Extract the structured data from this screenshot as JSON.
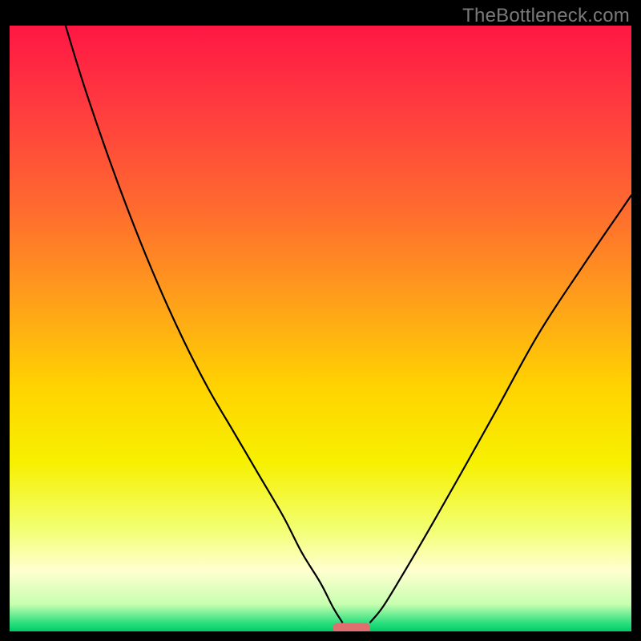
{
  "watermark": "TheBottleneck.com",
  "colors": {
    "background_black": "#000000",
    "gradient_stops": [
      {
        "offset": 0.0,
        "color": "#ff1744"
      },
      {
        "offset": 0.12,
        "color": "#ff3740"
      },
      {
        "offset": 0.3,
        "color": "#ff6a2f"
      },
      {
        "offset": 0.45,
        "color": "#ff9e1b"
      },
      {
        "offset": 0.6,
        "color": "#ffd400"
      },
      {
        "offset": 0.72,
        "color": "#f7f000"
      },
      {
        "offset": 0.83,
        "color": "#f2ff70"
      },
      {
        "offset": 0.9,
        "color": "#ffffd0"
      },
      {
        "offset": 0.955,
        "color": "#c8ffb0"
      },
      {
        "offset": 0.985,
        "color": "#30e080"
      },
      {
        "offset": 1.0,
        "color": "#00cc66"
      }
    ],
    "curve_stroke": "#000000",
    "marker_fill": "#e07070"
  },
  "chart_data": {
    "type": "line",
    "title": "",
    "xlabel": "",
    "ylabel": "",
    "xlim": [
      0,
      100
    ],
    "ylim": [
      0,
      100
    ],
    "series": [
      {
        "name": "left-branch",
        "x": [
          9,
          12,
          16,
          20,
          24,
          28,
          32,
          36,
          40,
          44,
          47,
          50,
          52,
          53.5
        ],
        "y": [
          100,
          90,
          78,
          67,
          57,
          48,
          40,
          33,
          26,
          19,
          13,
          8,
          4,
          1.5
        ]
      },
      {
        "name": "right-branch",
        "x": [
          58,
          60,
          63,
          67,
          72,
          78,
          85,
          92,
          100
        ],
        "y": [
          1.5,
          4,
          9,
          16,
          25,
          36,
          49,
          60,
          72
        ]
      }
    ],
    "marker": {
      "name": "bottleneck-zone",
      "x_start": 52,
      "x_end": 58,
      "y": 0.6
    }
  }
}
